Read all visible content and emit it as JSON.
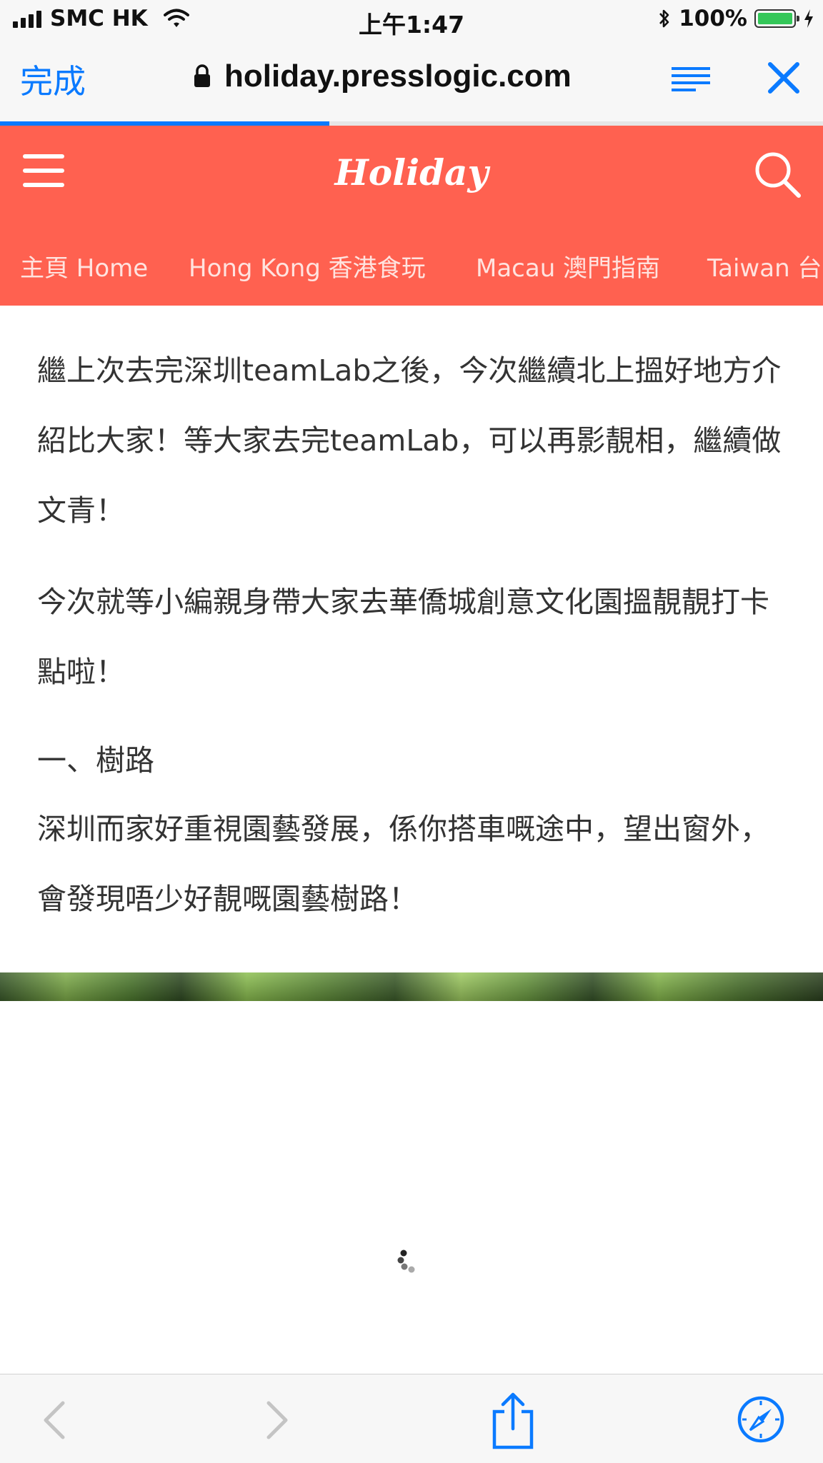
{
  "status_bar": {
    "carrier": "SMC HK",
    "time": "上午1:47",
    "battery_percent": "100%",
    "battery_level": 1.0
  },
  "browser": {
    "done_label": "完成",
    "url": "holiday.presslogic.com",
    "load_progress": 0.4,
    "accent_color": "#0a7aff"
  },
  "site": {
    "logo": "Holiday",
    "brand_color": "#ff6150",
    "nav": [
      {
        "label": "主頁 Home"
      },
      {
        "label": "Hong Kong 香港食玩"
      },
      {
        "label": "Macau 澳門指南"
      },
      {
        "label": "Taiwan 台"
      }
    ]
  },
  "article": {
    "paragraph1": "繼上次去完深圳teamLab之後，今次繼續北上搵好地方介紹比大家！等大家去完teamLab，可以再影靚相，繼續做文青！",
    "paragraph2": "今次就等小編親身帶大家去華僑城創意文化園搵靚靚打卡點啦！",
    "heading": "一、樹路",
    "paragraph3": "深圳而家好重視園藝發展，係你搭車嘅途中，望出窗外，會發現唔少好靚嘅園藝樹路！"
  },
  "icons": {
    "lock": "lock-icon",
    "reader": "reader-mode-icon",
    "close": "close-icon",
    "menu": "menu-icon",
    "search": "search-icon",
    "back": "back-arrow-icon",
    "forward": "forward-arrow-icon",
    "share": "share-icon",
    "safari": "compass-icon",
    "spinner": "loading-spinner-icon"
  }
}
